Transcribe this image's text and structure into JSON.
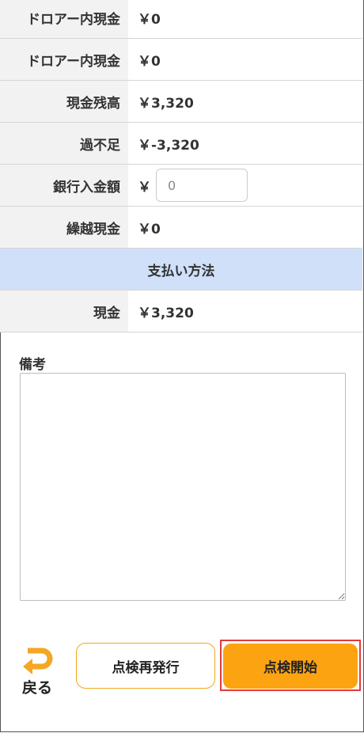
{
  "rows": [
    {
      "label": "ドロアー内現金",
      "value": "￥0"
    },
    {
      "label": "ドロアー内現金",
      "value": "￥0"
    },
    {
      "label": "現金残高",
      "value": "￥3,320"
    },
    {
      "label": "過不足",
      "value": "￥-3,320"
    },
    {
      "label": "銀行入金額",
      "currency": "￥",
      "input_value": "0"
    },
    {
      "label": "繰越現金",
      "value": "￥0"
    }
  ],
  "payment": {
    "header": "支払い方法",
    "rows": [
      {
        "label": "現金",
        "value": "￥3,320"
      }
    ]
  },
  "remarks": {
    "label": "備考",
    "value": ""
  },
  "footer": {
    "back_label": "戻る",
    "reissue_label": "点検再発行",
    "start_label": "点検開始"
  },
  "colors": {
    "accent": "#fca311",
    "section_bg": "#cfe0f8",
    "highlight_border": "#e03a3a",
    "label_bg": "#f2f2f2"
  },
  "icons": {
    "back": "return-arrow-icon"
  }
}
